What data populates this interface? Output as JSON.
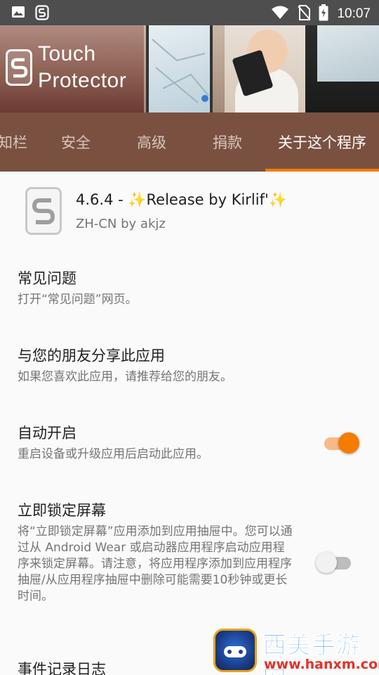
{
  "status_bar": {
    "time": "10:07",
    "icons": [
      "image-icon",
      "app-notification-icon",
      "wifi-icon",
      "no-sim-icon",
      "battery-charging-icon"
    ]
  },
  "banner": {
    "logo_line1": "Touch",
    "logo_line2": "Protector"
  },
  "tabs": [
    {
      "label": "知栏",
      "active": false
    },
    {
      "label": "安全",
      "active": false
    },
    {
      "label": "高级",
      "active": false
    },
    {
      "label": "捐款",
      "active": false
    },
    {
      "label": "关于这个程序",
      "active": true
    }
  ],
  "app": {
    "version_prefix": "4.6.4 - ",
    "version_release": "Release by Kirlif'",
    "sparkle": "✨",
    "subtitle": "ZH-CN by akjz"
  },
  "prefs": [
    {
      "title": "常见问题",
      "summary": "打开“常见问题”网页。"
    },
    {
      "title": "与您的朋友分享此应用",
      "summary": "如果您喜欢此应用，请推荐给您的朋友。"
    },
    {
      "title": "自动开启",
      "summary": "重启设备或升级应用后启动此应用。",
      "switch": "on"
    },
    {
      "title": "立即锁定屏幕",
      "summary": "将“立即锁定屏幕”应用添加到应用抽屉中。您可以通过从 Android Wear 或启动器应用程序启动应用程序来锁定屏幕。请注意，将应用程序添加到应用程序抽屉/从应用程序抽屉中删除可能需要10秒钟或更长时间。",
      "switch": "off"
    },
    {
      "title": "事件记录日志"
    }
  ],
  "watermark": {
    "title": "西美手游网",
    "url": "www.hanxm.com"
  },
  "colors": {
    "tab_bar": "#7a5141",
    "accent": "#f57c00",
    "status_bar": "#4e4e4e"
  }
}
